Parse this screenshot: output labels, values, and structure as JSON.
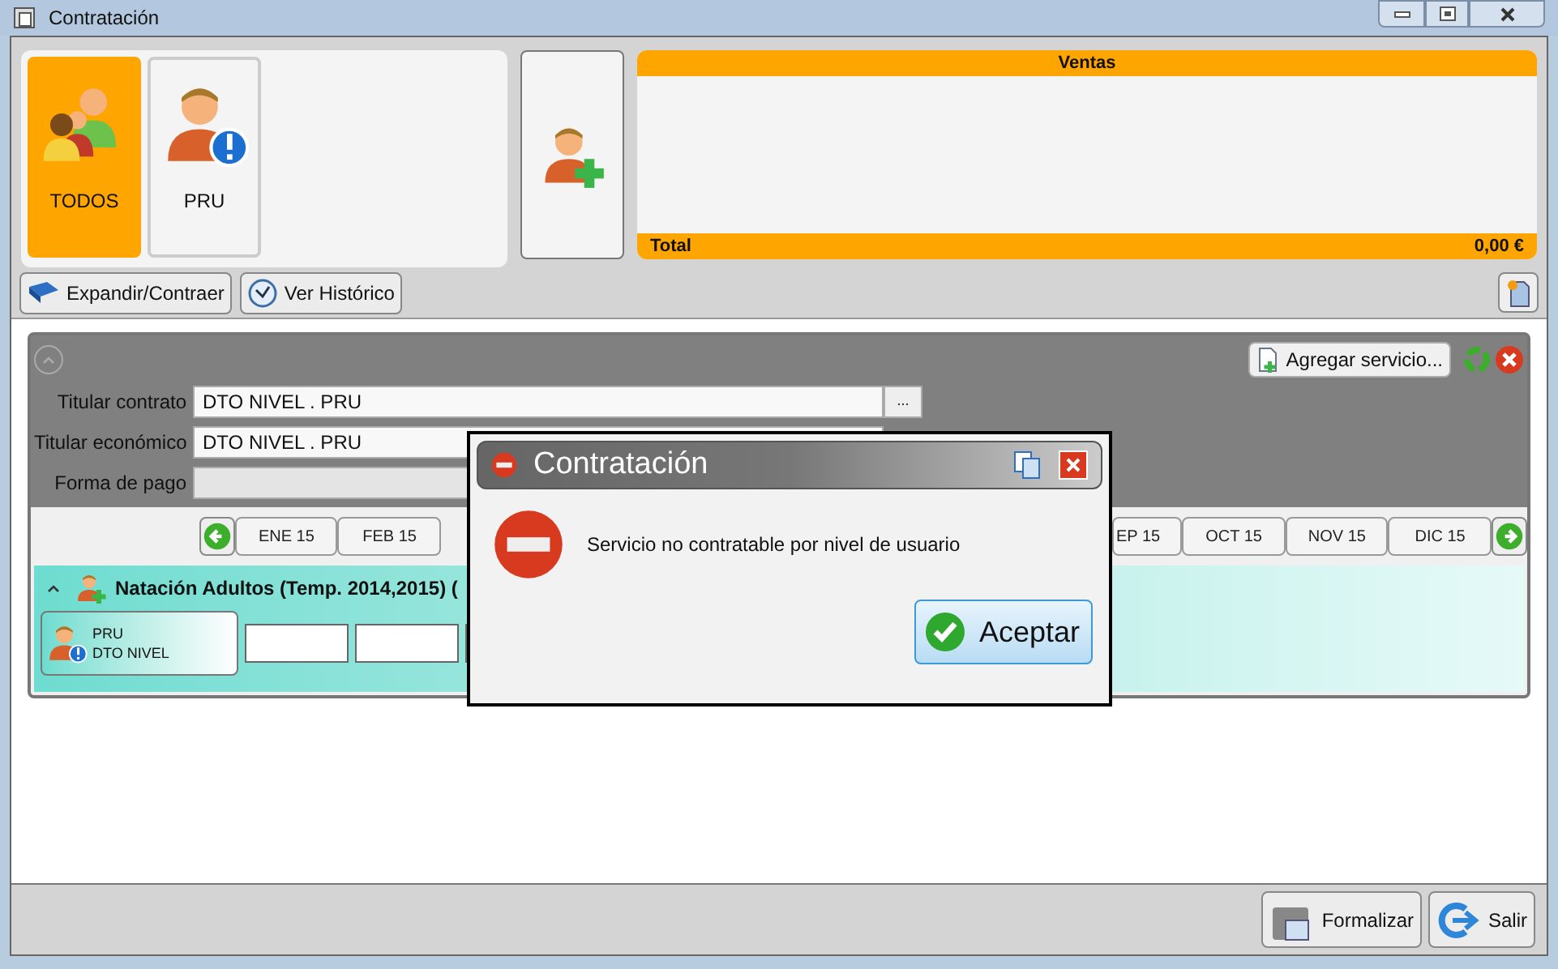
{
  "window": {
    "title": "Contratación"
  },
  "members": [
    {
      "label": "TODOS",
      "kind": "group",
      "selected": true
    },
    {
      "label": "PRU",
      "kind": "alert",
      "selected": false
    }
  ],
  "sales": {
    "title": "Ventas",
    "total_label": "Total",
    "total": "0,00 €"
  },
  "toolbar": [
    "Expandir/Contraer",
    "Ver Histórico"
  ],
  "contract": {
    "add_service": "Agregar servicio...",
    "fields": [
      {
        "label": "Titular contrato",
        "value": "DTO NIVEL . PRU",
        "browse": "..."
      },
      {
        "label": "Titular económico",
        "value": "DTO NIVEL . PRU"
      },
      {
        "label": "Forma de pago"
      }
    ],
    "months_before": [
      "ENE 15",
      "FEB 15"
    ],
    "months_after": [
      "EP 15",
      "OCT 15",
      "NOV 15",
      "DIC 15"
    ],
    "service": {
      "title": "Natación Adultos (Temp. 2014,2015) (",
      "person": "PRU",
      "person_group": "DTO NIVEL"
    }
  },
  "dialog": {
    "title": "Contratación",
    "message": "Servicio no contratable por nivel de usuario",
    "button": "Aceptar"
  },
  "footer": [
    "Formalizar",
    "Salir"
  ]
}
